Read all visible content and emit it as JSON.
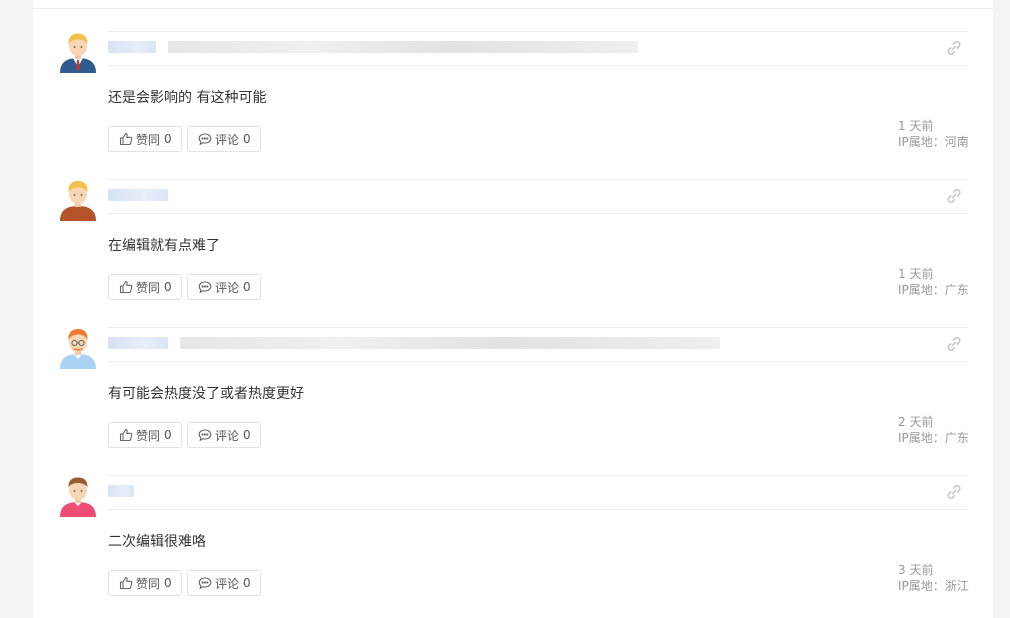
{
  "comments": [
    {
      "avatar": "man-in-suit-avatar-icon",
      "text": "还是会影响的 有这种可能",
      "time": "1 天前",
      "ip": "IP属地：河南",
      "agree_label": "赞同",
      "agree_count": "0",
      "reply_label": "评论",
      "reply_count": "0"
    },
    {
      "avatar": "man-brown-shirt-avatar-icon",
      "text": "在编辑就有点难了",
      "time": "1 天前",
      "ip": "IP属地：广东",
      "agree_label": "赞同",
      "agree_count": "0",
      "reply_label": "评论",
      "reply_count": "0"
    },
    {
      "avatar": "man-with-glasses-avatar-icon",
      "text": "有可能会热度没了或者热度更好",
      "time": "2 天前",
      "ip": "IP属地：广东",
      "agree_label": "赞同",
      "agree_count": "0",
      "reply_label": "评论",
      "reply_count": "0"
    },
    {
      "avatar": "man-pink-shirt-avatar-icon",
      "text": "二次编辑很难咯",
      "time": "3 天前",
      "ip": "IP属地：浙江",
      "agree_label": "赞同",
      "agree_count": "0",
      "reply_label": "评论",
      "reply_count": "0"
    }
  ],
  "colors": {
    "page_background": "#f3f4f6",
    "card_background": "#ffffff",
    "text": "#333333",
    "meta_text": "#999999",
    "border": "#e2e2e2"
  },
  "icons": {
    "agree": "thumbs-up-icon",
    "reply": "speech-bubble-icon",
    "permalink": "link-icon"
  }
}
